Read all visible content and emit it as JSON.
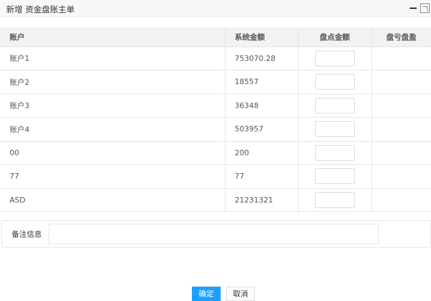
{
  "window": {
    "title": "新增 资金盘账主单"
  },
  "table": {
    "headers": [
      "账户",
      "系统金额",
      "盘点金额",
      "盘亏盘盈"
    ],
    "rows": [
      {
        "account": "账户1",
        "system_amount": "753070.28"
      },
      {
        "account": "账户2",
        "system_amount": "18557"
      },
      {
        "account": "账户3",
        "system_amount": "36348"
      },
      {
        "account": "账户4",
        "system_amount": "503957"
      },
      {
        "account": "00",
        "system_amount": "200"
      },
      {
        "account": "77",
        "system_amount": "77"
      },
      {
        "account": "ASD",
        "system_amount": "21231321"
      }
    ]
  },
  "remark": {
    "label": "备注信息"
  },
  "buttons": {
    "ok": "确定",
    "cancel": "取消"
  }
}
